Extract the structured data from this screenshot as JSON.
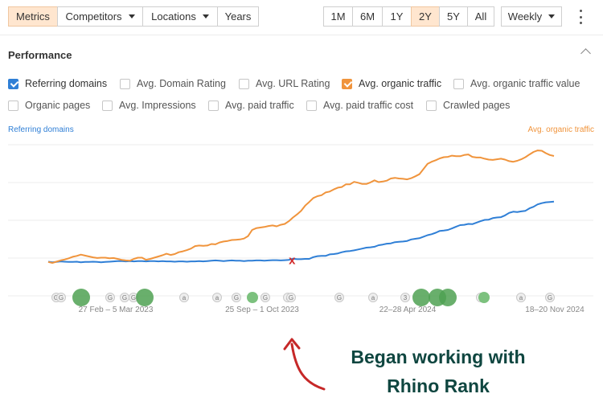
{
  "toolbar": {
    "tabs": [
      {
        "label": "Metrics",
        "active": true
      },
      {
        "label": "Competitors",
        "dropdown": true
      },
      {
        "label": "Locations",
        "dropdown": true
      },
      {
        "label": "Years"
      }
    ],
    "ranges": [
      {
        "label": "1M"
      },
      {
        "label": "6M"
      },
      {
        "label": "1Y"
      },
      {
        "label": "2Y",
        "active": true
      },
      {
        "label": "5Y"
      },
      {
        "label": "All"
      }
    ],
    "interval": "Weekly",
    "more_icon": "kebab-menu-icon"
  },
  "section": {
    "title": "Performance",
    "collapse_icon": "chevron-up-icon"
  },
  "metrics": [
    {
      "label": "Referring domains",
      "checked": true,
      "color": "#2f7fd6"
    },
    {
      "label": "Avg. Domain Rating",
      "checked": false
    },
    {
      "label": "Avg. URL Rating",
      "checked": false
    },
    {
      "label": "Avg. organic traffic",
      "checked": true,
      "color": "#f0943c"
    },
    {
      "label": "Avg. organic traffic value",
      "checked": false
    },
    {
      "label": "Organic pages",
      "checked": false
    },
    {
      "label": "Avg. Impressions",
      "checked": false
    },
    {
      "label": "Avg. paid traffic",
      "checked": false
    },
    {
      "label": "Avg. paid traffic cost",
      "checked": false
    },
    {
      "label": "Crawled pages",
      "checked": false
    }
  ],
  "chart_data": {
    "type": "line",
    "ylabel_left": "Referring domains",
    "ylabel_right": "Avg. organic traffic",
    "grid": true,
    "x_labels": [
      "27 Feb – 5 Mar 2023",
      "25 Sep – 1 Oct 2023",
      "22–28 Apr 2024",
      "18–20 Nov 2024"
    ],
    "series": [
      {
        "name": "Referring domains",
        "color": "#2f7fd6",
        "axis": "left",
        "values": [
          1.2,
          1.0,
          1.1,
          1.3,
          1.2,
          1.1,
          1.1,
          1.2,
          1.0,
          1.1,
          1.1,
          1.2,
          1.1,
          1.0,
          1.1,
          1.2,
          1.3,
          1.4,
          1.4,
          1.3,
          1.4,
          1.3,
          1.4,
          1.4,
          1.3,
          1.4,
          1.4,
          1.3,
          1.4,
          1.3,
          1.3,
          1.2,
          1.3,
          1.3,
          1.2,
          1.3,
          1.3,
          1.4,
          1.3,
          1.4,
          1.5,
          1.6,
          1.5,
          1.4,
          1.5,
          1.6,
          1.5,
          1.5,
          1.4,
          1.5,
          1.5,
          1.6,
          1.6,
          1.5,
          1.6,
          1.7,
          1.7,
          1.6,
          1.7,
          1.8,
          2.2,
          2.0,
          2.0,
          2.1,
          2.1,
          2.7,
          3.0,
          3.1,
          3.1,
          3.6,
          3.7,
          3.9,
          4.3,
          4.6,
          4.7,
          4.9,
          5.2,
          5.5,
          5.8,
          5.9,
          6.1,
          6.6,
          6.8,
          7.1,
          7.2,
          7.6,
          7.7,
          7.8,
          8.0,
          8.5,
          8.7,
          8.9,
          9.4,
          9.9,
          10.2,
          10.7,
          11.3,
          11.4,
          11.6,
          12.1,
          12.7,
          13.2,
          13.3,
          13.6,
          13.5,
          14.0,
          14.5,
          14.9,
          15.0,
          15.5,
          15.7,
          15.8,
          16.4,
          17.2,
          17.6,
          17.5,
          17.7,
          17.9,
          18.7,
          19.2,
          20.0,
          20.4,
          20.7,
          20.8,
          20.9
        ]
      },
      {
        "name": "Avg. organic traffic",
        "color": "#f0943c",
        "axis": "right",
        "values": [
          1.1,
          0.8,
          1.2,
          1.6,
          1.9,
          2.3,
          2.8,
          3.1,
          3.5,
          3.2,
          2.9,
          2.6,
          2.4,
          2.5,
          2.5,
          2.3,
          2.4,
          2.1,
          1.8,
          1.6,
          1.5,
          2.1,
          2.5,
          2.5,
          1.8,
          2.1,
          2.5,
          2.9,
          3.3,
          3.8,
          3.4,
          3.7,
          4.3,
          4.6,
          5.0,
          5.5,
          6.3,
          6.5,
          6.4,
          6.5,
          7.0,
          6.9,
          7.5,
          7.8,
          8.0,
          8.3,
          8.4,
          8.5,
          8.8,
          9.6,
          11.6,
          12.2,
          12.4,
          12.6,
          12.9,
          13.1,
          12.8,
          13.3,
          13.6,
          14.5,
          15.7,
          16.7,
          17.9,
          19.6,
          20.8,
          22.1,
          22.7,
          23.0,
          23.9,
          24.2,
          24.9,
          25.5,
          25.7,
          26.6,
          26.6,
          27.4,
          27.1,
          26.7,
          26.7,
          27.2,
          27.9,
          27.3,
          27.5,
          27.8,
          28.5,
          28.7,
          28.5,
          28.4,
          28.2,
          28.6,
          29.2,
          29.9,
          31.6,
          33.3,
          34.0,
          34.5,
          35.1,
          35.5,
          35.6,
          36.0,
          35.8,
          35.8,
          36.2,
          36.4,
          35.6,
          35.4,
          35.4,
          35.0,
          34.7,
          34.6,
          34.8,
          35.0,
          34.7,
          34.2,
          34.0,
          34.3,
          34.8,
          35.5,
          36.4,
          37.2,
          37.7,
          37.6,
          36.8,
          36.2,
          35.9
        ]
      }
    ],
    "annotation": {
      "label": "x",
      "color": "#d22b2b",
      "index": 60
    },
    "events": [
      {
        "text": "G",
        "color": "#eeeeee",
        "big": false
      },
      {
        "text": "G",
        "color": "#eeeeee",
        "big": false
      },
      {
        "text": "",
        "color": "#4fa152",
        "big": true
      },
      {
        "text": "G",
        "color": "#eeeeee",
        "big": false
      },
      {
        "text": "G",
        "color": "#eeeeee",
        "big": false
      },
      {
        "text": "G",
        "color": "#eeeeee",
        "big": false
      },
      {
        "text": "",
        "color": "#4fa152",
        "big": true
      },
      {
        "text": "a",
        "color": "#eeeeee",
        "big": false
      },
      {
        "text": "a",
        "color": "#eeeeee",
        "big": false
      },
      {
        "text": "G",
        "color": "#eeeeee",
        "big": false
      },
      {
        "text": "",
        "color": "#7cc17e",
        "big": false
      },
      {
        "text": "G",
        "color": "#eeeeee",
        "big": false
      },
      {
        "text": "a",
        "color": "#eeeeee",
        "big": false
      },
      {
        "text": "G",
        "color": "#eeeeee",
        "big": false
      },
      {
        "text": "G",
        "color": "#eeeeee",
        "big": false
      },
      {
        "text": "a",
        "color": "#eeeeee",
        "big": false
      },
      {
        "text": "3",
        "color": "#eeeeee",
        "big": false
      },
      {
        "text": "",
        "color": "#4fa152",
        "big": true
      },
      {
        "text": "",
        "color": "#4fa152",
        "big": true
      },
      {
        "text": "",
        "color": "#4fa152",
        "big": true
      },
      {
        "text": "G",
        "color": "#eeeeee",
        "big": false
      },
      {
        "text": "",
        "color": "#7cc17e",
        "big": false
      },
      {
        "text": "a",
        "color": "#eeeeee",
        "big": false
      },
      {
        "text": "G",
        "color": "#eeeeee",
        "big": false
      }
    ]
  },
  "callout": {
    "line1": "Began working with",
    "line2": "Rhino Rank",
    "arrow_color": "#c62828"
  }
}
